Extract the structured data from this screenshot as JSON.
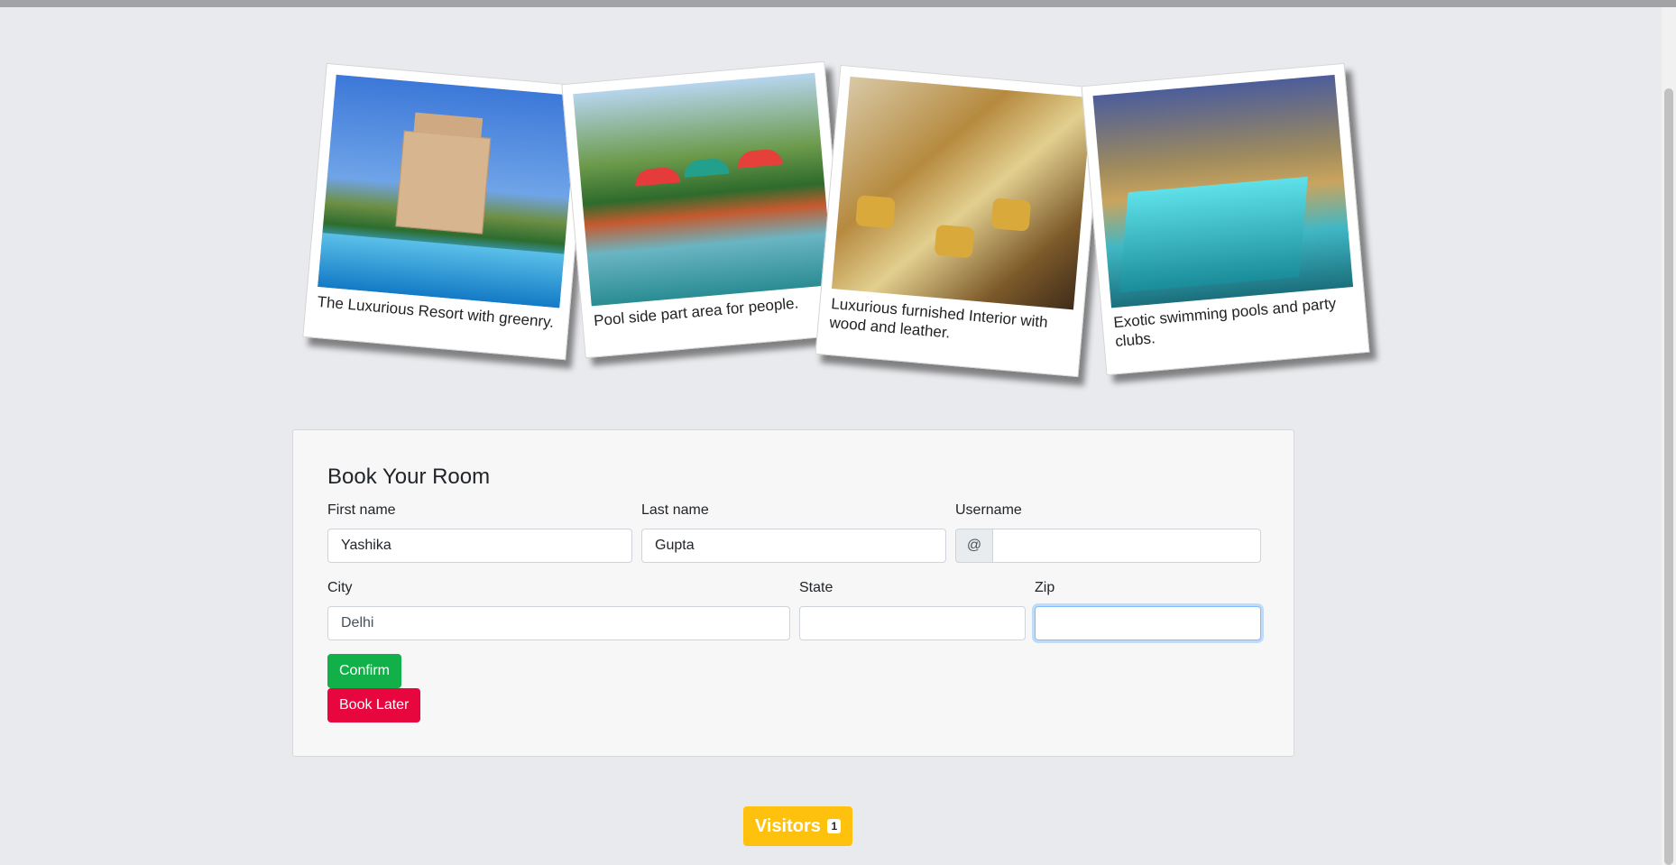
{
  "gallery": [
    {
      "caption": "The Luxurious Resort with greenry."
    },
    {
      "caption": "Pool side part area for people."
    },
    {
      "caption": "Luxurious furnished Interior with wood and leather."
    },
    {
      "caption": "Exotic swimming pools and party clubs."
    }
  ],
  "form": {
    "title": "Book Your Room",
    "first_name": {
      "label": "First name",
      "value": "Yashika"
    },
    "last_name": {
      "label": "Last name",
      "value": "Gupta"
    },
    "username": {
      "label": "Username",
      "prefix": "@",
      "value": ""
    },
    "city": {
      "label": "City",
      "value": "Delhi"
    },
    "state": {
      "label": "State",
      "value": ""
    },
    "zip": {
      "label": "Zip",
      "value": ""
    },
    "confirm_label": "Confirm",
    "later_label": "Book Later"
  },
  "visitors": {
    "label": "Visitors",
    "count": "1"
  },
  "colors": {
    "confirm": "#11b049",
    "book_later": "#e8063f",
    "visitors": "#fec20e"
  }
}
